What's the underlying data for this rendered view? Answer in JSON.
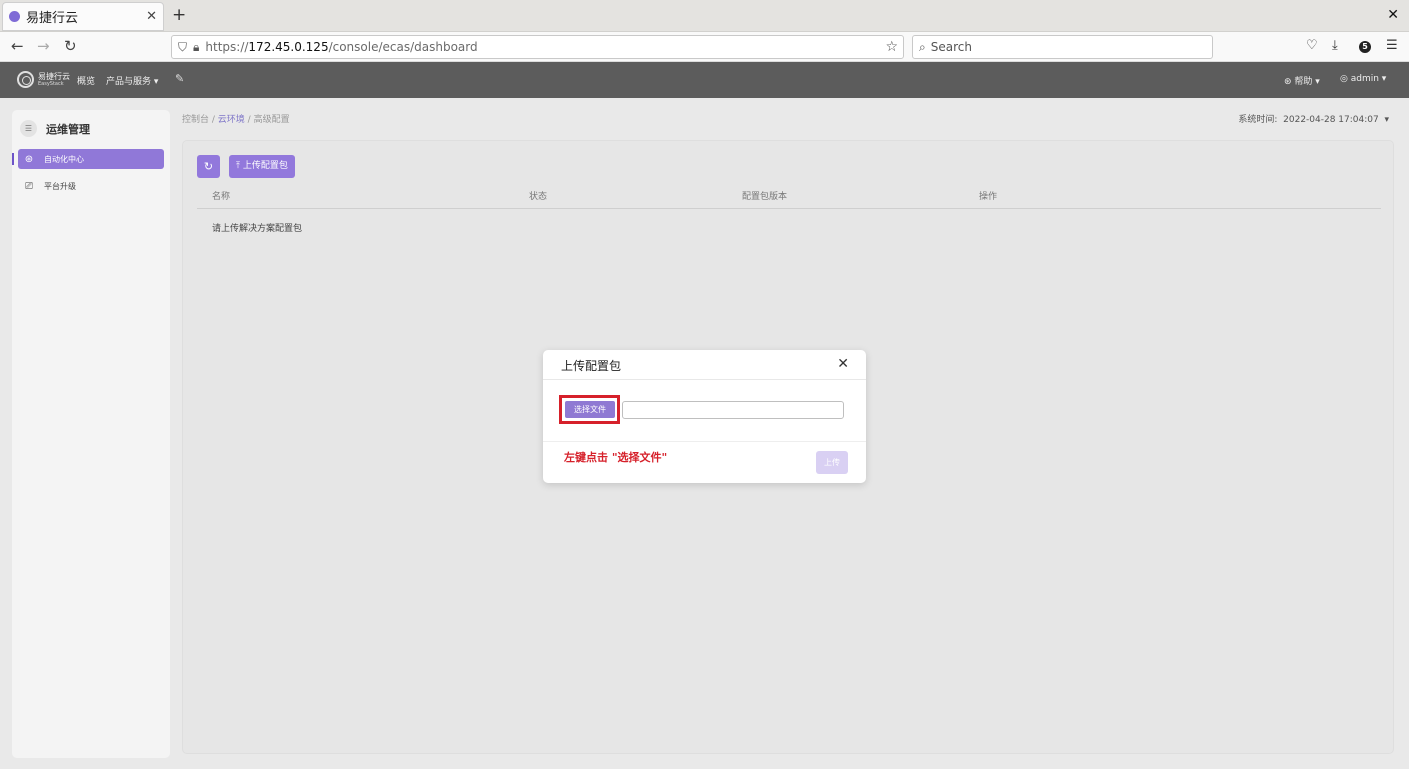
{
  "browser": {
    "tab_title": "易捷行云",
    "tab_close": "✕",
    "new_tab": "+",
    "window_close": "✕",
    "url_proto": "https://",
    "url_host": "172.45.0.125",
    "url_path": "/console/ecas/dashboard",
    "search_placeholder": "Search",
    "extension_badge": "5"
  },
  "header": {
    "logo_cn": "易捷行云",
    "logo_en": "EasyStack",
    "nav_overview": "概览",
    "nav_products": "产品与服务 ▾",
    "help": "帮助 ▾",
    "user": "admin ▾"
  },
  "sidebar": {
    "title": "运维管理",
    "items": [
      {
        "label": "自动化中心"
      },
      {
        "label": "平台升级"
      }
    ]
  },
  "breadcrumb": {
    "home": "控制台 /",
    "env": "云环境",
    "sep": "/",
    "current": "高级配置"
  },
  "system_time": {
    "label": "系统时间:",
    "value": "2022-04-28 17:04:07"
  },
  "toolbar": {
    "upload_label": "上传配置包"
  },
  "table": {
    "headers": [
      "名称",
      "状态",
      "配置包版本",
      "操作"
    ],
    "empty_text": "请上传解决方案配置包"
  },
  "modal": {
    "title": "上传配置包",
    "choose_file": "选择文件",
    "submit": "上传",
    "instruction": "左键点击 \"选择文件\""
  }
}
